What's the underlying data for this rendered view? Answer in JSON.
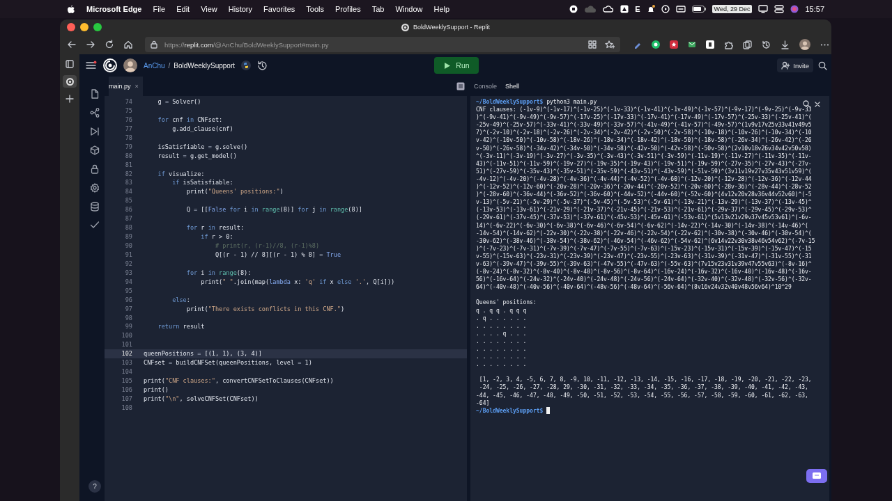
{
  "menu_bar": {
    "app": "Microsoft Edge",
    "menus": [
      "File",
      "Edit",
      "View",
      "History",
      "Favorites",
      "Tools",
      "Profiles",
      "Tab",
      "Window",
      "Help"
    ],
    "status_letter": "E",
    "date": "Wed, 29 Dec",
    "time": "15:57"
  },
  "browser": {
    "tab_title": "BoldWeeklySupport - Replit",
    "url": {
      "scheme": "https://",
      "host": "replit.com",
      "path": "/@AnChu/BoldWeeklySupport#main.py"
    }
  },
  "replit_header": {
    "user": "AnChu",
    "separator": "/",
    "repl": "BoldWeeklySupport",
    "run_label": "Run",
    "invite_label": "Invite"
  },
  "sidebar": {
    "help_label": "?"
  },
  "editor": {
    "tab": {
      "label": "main.py",
      "close": "×"
    },
    "lines": [
      {
        "number": "74",
        "active": false,
        "tokens": [
          {
            "text": "    g ",
            "kind": "plain"
          },
          {
            "text": "=",
            "kind": "op"
          },
          {
            "text": " Solver()",
            "kind": "plain"
          }
        ]
      },
      {
        "number": "75",
        "active": false
      },
      {
        "number": "76",
        "active": false,
        "tokens": [
          {
            "text": "    for",
            "kind": "keyword"
          },
          {
            "text": " cnf ",
            "kind": "plain"
          },
          {
            "text": "in",
            "kind": "keyword"
          },
          {
            "text": " CNFset:",
            "kind": "plain"
          }
        ]
      },
      {
        "number": "77",
        "active": false,
        "tokens": [
          {
            "text": "        g.add_clause(cnf)",
            "kind": "plain"
          }
        ]
      },
      {
        "number": "78",
        "active": false
      },
      {
        "number": "79",
        "active": false,
        "tokens": [
          {
            "text": "    isSatisfiable ",
            "kind": "plain"
          },
          {
            "text": "=",
            "kind": "op"
          },
          {
            "text": " g.solve()",
            "kind": "plain"
          }
        ]
      },
      {
        "number": "80",
        "active": false,
        "tokens": [
          {
            "text": "    result ",
            "kind": "plain"
          },
          {
            "text": "=",
            "kind": "op"
          },
          {
            "text": " g.get_model()",
            "kind": "plain"
          }
        ]
      },
      {
        "number": "81",
        "active": false
      },
      {
        "number": "82",
        "active": false,
        "tokens": [
          {
            "text": "    if",
            "kind": "keyword"
          },
          {
            "text": " visualize:",
            "kind": "plain"
          }
        ]
      },
      {
        "number": "83",
        "active": false,
        "tokens": [
          {
            "text": "        if",
            "kind": "keyword"
          },
          {
            "text": " isSatisfiable:",
            "kind": "plain"
          }
        ]
      },
      {
        "number": "84",
        "active": false,
        "tokens": [
          {
            "text": "            print(",
            "kind": "plain"
          },
          {
            "text": "\"Queens' positions:\"",
            "kind": "string"
          },
          {
            "text": ")",
            "kind": "plain"
          }
        ]
      },
      {
        "number": "85",
        "active": false
      },
      {
        "number": "86",
        "active": false,
        "tokens": [
          {
            "text": "            Q ",
            "kind": "plain"
          },
          {
            "text": "=",
            "kind": "op"
          },
          {
            "text": " [[",
            "kind": "plain"
          },
          {
            "text": "False",
            "kind": "constant"
          },
          {
            "text": " for",
            "kind": "keyword"
          },
          {
            "text": " i ",
            "kind": "plain"
          },
          {
            "text": "in",
            "kind": "keyword"
          },
          {
            "text": " range",
            "kind": "builtin"
          },
          {
            "text": "(8)] ",
            "kind": "plain"
          },
          {
            "text": "for",
            "kind": "keyword"
          },
          {
            "text": " j ",
            "kind": "plain"
          },
          {
            "text": "in",
            "kind": "keyword"
          },
          {
            "text": " range",
            "kind": "builtin"
          },
          {
            "text": "(8)]",
            "kind": "plain"
          }
        ]
      },
      {
        "number": "87",
        "active": false
      },
      {
        "number": "88",
        "active": false,
        "tokens": [
          {
            "text": "            for",
            "kind": "keyword"
          },
          {
            "text": " r ",
            "kind": "plain"
          },
          {
            "text": "in",
            "kind": "keyword"
          },
          {
            "text": " result:",
            "kind": "plain"
          }
        ]
      },
      {
        "number": "89",
        "active": false,
        "tokens": [
          {
            "text": "                if",
            "kind": "keyword"
          },
          {
            "text": " r > 0:",
            "kind": "plain"
          }
        ]
      },
      {
        "number": "90",
        "active": false,
        "tokens": [
          {
            "text": "                    # print(r, (r-1)//8, (r-1)%8)",
            "kind": "comment"
          }
        ]
      },
      {
        "number": "91",
        "active": false,
        "tokens": [
          {
            "text": "                    Q[(r - 1) // 8][(r - 1) % 8] ",
            "kind": "plain"
          },
          {
            "text": "=",
            "kind": "op"
          },
          {
            "text": " True",
            "kind": "constant"
          }
        ]
      },
      {
        "number": "92",
        "active": false
      },
      {
        "number": "93",
        "active": false,
        "tokens": [
          {
            "text": "            for",
            "kind": "keyword"
          },
          {
            "text": " i ",
            "kind": "plain"
          },
          {
            "text": "in",
            "kind": "keyword"
          },
          {
            "text": " range",
            "kind": "builtin"
          },
          {
            "text": "(8):",
            "kind": "plain"
          }
        ]
      },
      {
        "number": "94",
        "active": false,
        "tokens": [
          {
            "text": "                print(",
            "kind": "plain"
          },
          {
            "text": "\" \"",
            "kind": "string"
          },
          {
            "text": ".join(map(",
            "kind": "plain"
          },
          {
            "text": "lambda",
            "kind": "constant"
          },
          {
            "text": " x: ",
            "kind": "plain"
          },
          {
            "text": "'q'",
            "kind": "string"
          },
          {
            "text": " if",
            "kind": "keyword"
          },
          {
            "text": " x ",
            "kind": "plain"
          },
          {
            "text": "else",
            "kind": "keyword"
          },
          {
            "text": " '.'",
            "kind": "string"
          },
          {
            "text": ", Q[i]))",
            "kind": "plain"
          }
        ]
      },
      {
        "number": "95",
        "active": false
      },
      {
        "number": "96",
        "active": false,
        "tokens": [
          {
            "text": "        else",
            "kind": "keyword"
          },
          {
            "text": ":",
            "kind": "plain"
          }
        ]
      },
      {
        "number": "97",
        "active": false,
        "tokens": [
          {
            "text": "            print(",
            "kind": "plain"
          },
          {
            "text": "\"There exists conflicts in this CNF.\"",
            "kind": "string"
          },
          {
            "text": ")",
            "kind": "plain"
          }
        ]
      },
      {
        "number": "98",
        "active": false
      },
      {
        "number": "99",
        "active": false,
        "tokens": [
          {
            "text": "    return",
            "kind": "keyword"
          },
          {
            "text": " result",
            "kind": "plain"
          }
        ]
      },
      {
        "number": "100",
        "active": false
      },
      {
        "number": "101",
        "active": false
      },
      {
        "number": "102",
        "active": true,
        "tokens": [
          {
            "text": "queenPositions ",
            "kind": "plain"
          },
          {
            "text": "=",
            "kind": "op"
          },
          {
            "text": " [(1, 1), (3, 4)]",
            "kind": "plain"
          }
        ]
      },
      {
        "number": "103",
        "active": false,
        "tokens": [
          {
            "text": "CNFset ",
            "kind": "plain"
          },
          {
            "text": "=",
            "kind": "op"
          },
          {
            "text": " buildCNFSet(queenPositions, level ",
            "kind": "plain"
          },
          {
            "text": "=",
            "kind": "op"
          },
          {
            "text": " 1)",
            "kind": "plain"
          }
        ]
      },
      {
        "number": "104",
        "active": false
      },
      {
        "number": "105",
        "active": false,
        "tokens": [
          {
            "text": "print(",
            "kind": "plain"
          },
          {
            "text": "\"CNF clauses:\"",
            "kind": "string"
          },
          {
            "text": ", convertCNFSetToClauses(CNFset))",
            "kind": "plain"
          }
        ]
      },
      {
        "number": "106",
        "active": false,
        "tokens": [
          {
            "text": "print()",
            "kind": "plain"
          }
        ]
      },
      {
        "number": "107",
        "active": false,
        "tokens": [
          {
            "text": "print(",
            "kind": "plain"
          },
          {
            "text": "\"\\n\"",
            "kind": "string"
          },
          {
            "text": ", solveCNFSet(CNFset))",
            "kind": "plain"
          }
        ]
      },
      {
        "number": "108",
        "active": false
      }
    ]
  },
  "output_panel": {
    "tabs": [
      {
        "label": "Console",
        "selected": false
      },
      {
        "label": "Shell",
        "selected": true
      }
    ],
    "blocks": [
      {
        "lines": [
          {
            "kind": "prompt",
            "prompt": "~/BoldWeeklySupport$",
            "command": "python3 main.py"
          },
          {
            "kind": "text",
            "text": "CNF clauses: (-1v-9)^(-1v-17)^(-1v-25)^(-1v-33)^(-1v-41)^(-1v-49)^(-1v-57)^(-9v-17)^(-9v-25)^(-9v-33"
          },
          {
            "kind": "text",
            "text": ")^(-9v-41)^(-9v-49)^(-9v-57)^(-17v-25)^(-17v-33)^(-17v-41)^(-17v-49)^(-17v-57)^(-25v-33)^(-25v-41)^("
          },
          {
            "kind": "text",
            "text": "-25v-49)^(-25v-57)^(-33v-41)^(-33v-49)^(-33v-57)^(-41v-49)^(-41v-57)^(-49v-57)^(1v9v17v25v33v41v49v5"
          },
          {
            "kind": "text",
            "text": "7)^(-2v-10)^(-2v-18)^(-2v-26)^(-2v-34)^(-2v-42)^(-2v-50)^(-2v-58)^(-10v-18)^(-10v-26)^(-10v-34)^(-10"
          },
          {
            "kind": "text",
            "text": "v-42)^(-10v-50)^(-10v-58)^(-18v-26)^(-18v-34)^(-18v-42)^(-18v-50)^(-18v-58)^(-26v-34)^(-26v-42)^(-26"
          },
          {
            "kind": "text",
            "text": "v-50)^(-26v-58)^(-34v-42)^(-34v-50)^(-34v-58)^(-42v-50)^(-42v-58)^(-50v-58)^(2v10v18v26v34v42v50v58)"
          },
          {
            "kind": "text",
            "text": "^(-3v-11)^(-3v-19)^(-3v-27)^(-3v-35)^(-3v-43)^(-3v-51)^(-3v-59)^(-11v-19)^(-11v-27)^(-11v-35)^(-11v-"
          },
          {
            "kind": "text",
            "text": "43)^(-11v-51)^(-11v-59)^(-19v-27)^(-19v-35)^(-19v-43)^(-19v-51)^(-19v-59)^(-27v-35)^(-27v-43)^(-27v-"
          },
          {
            "kind": "text",
            "text": "51)^(-27v-59)^(-35v-43)^(-35v-51)^(-35v-59)^(-43v-51)^(-43v-59)^(-51v-59)^(3v11v19v27v35v43v51v59)^("
          },
          {
            "kind": "text",
            "text": "-4v-12)^(-4v-20)^(-4v-28)^(-4v-36)^(-4v-44)^(-4v-52)^(-4v-60)^(-12v-20)^(-12v-28)^(-12v-36)^(-12v-44"
          },
          {
            "kind": "text",
            "text": ")^(-12v-52)^(-12v-60)^(-20v-28)^(-20v-36)^(-20v-44)^(-20v-52)^(-20v-60)^(-28v-36)^(-28v-44)^(-28v-52"
          },
          {
            "kind": "text",
            "text": ")^(-28v-60)^(-36v-44)^(-36v-52)^(-36v-60)^(-44v-52)^(-44v-60)^(-52v-60)^(4v12v20v28v36v44v52v60)^(-5"
          },
          {
            "kind": "text",
            "text": "v-13)^(-5v-21)^(-5v-29)^(-5v-37)^(-5v-45)^(-5v-53)^(-5v-61)^(-13v-21)^(-13v-29)^(-13v-37)^(-13v-45)^"
          },
          {
            "kind": "text",
            "text": "(-13v-53)^(-13v-61)^(-21v-29)^(-21v-37)^(-21v-45)^(-21v-53)^(-21v-61)^(-29v-37)^(-29v-45)^(-29v-53)^"
          },
          {
            "kind": "text",
            "text": "(-29v-61)^(-37v-45)^(-37v-53)^(-37v-61)^(-45v-53)^(-45v-61)^(-53v-61)^(5v13v21v29v37v45v53v61)^(-6v-"
          },
          {
            "kind": "text",
            "text": "14)^(-6v-22)^(-6v-30)^(-6v-38)^(-6v-46)^(-6v-54)^(-6v-62)^(-14v-22)^(-14v-30)^(-14v-38)^(-14v-46)^("
          },
          {
            "kind": "text",
            "text": "-14v-54)^(-14v-62)^(-22v-30)^(-22v-38)^(-22v-46)^(-22v-54)^(-22v-62)^(-30v-38)^(-30v-46)^(-30v-54)^("
          },
          {
            "kind": "text",
            "text": "-30v-62)^(-38v-46)^(-38v-54)^(-38v-62)^(-46v-54)^(-46v-62)^(-54v-62)^(6v14v22v30v38v46v54v62)^(-7v-15"
          },
          {
            "kind": "text",
            "text": ")^(-7v-23)^(-7v-31)^(-7v-39)^(-7v-47)^(-7v-55)^(-7v-63)^(-15v-23)^(-15v-31)^(-15v-39)^(-15v-47)^(-15"
          },
          {
            "kind": "text",
            "text": "v-55)^(-15v-63)^(-23v-31)^(-23v-39)^(-23v-47)^(-23v-55)^(-23v-63)^(-31v-39)^(-31v-47)^(-31v-55)^(-31"
          },
          {
            "kind": "text",
            "text": "v-63)^(-39v-47)^(-39v-55)^(-39v-63)^(-47v-55)^(-47v-63)^(-55v-63)^(7v15v23v31v39v47v55v63)^(-8v-16)^"
          },
          {
            "kind": "text",
            "text": "(-8v-24)^(-8v-32)^(-8v-40)^(-8v-48)^(-8v-56)^(-8v-64)^(-16v-24)^(-16v-32)^(-16v-40)^(-16v-48)^(-16v-"
          },
          {
            "kind": "text",
            "text": "56)^(-16v-64)^(-24v-32)^(-24v-40)^(-24v-48)^(-24v-56)^(-24v-64)^(-32v-40)^(-32v-48)^(-32v-56)^(-32v-"
          },
          {
            "kind": "text",
            "text": "64)^(-40v-48)^(-40v-56)^(-40v-64)^(-48v-56)^(-48v-64)^(-56v-64)^(8v16v24v32v40v48v56v64)^10^29"
          }
        ]
      },
      {
        "lines": [
          {
            "kind": "text",
            "text": "Queens' positions:"
          },
          {
            "kind": "text",
            "text": "q . q q . q q q"
          },
          {
            "kind": "text",
            "text": ". q . . . . . ."
          },
          {
            "kind": "text",
            "text": ". . . . . . . ."
          },
          {
            "kind": "text",
            "text": ". . . . q . . ."
          },
          {
            "kind": "text",
            "text": ". . . . . . . ."
          },
          {
            "kind": "text",
            "text": ". . . . . . . ."
          },
          {
            "kind": "text",
            "text": ". . . . . . . ."
          },
          {
            "kind": "text",
            "text": ". . . . . . . ."
          }
        ]
      },
      {
        "lines": [
          {
            "kind": "text",
            "text": " [1, -2, 3, 4, -5, 6, 7, 8, -9, 10, -11, -12, -13, -14, -15, -16, -17, -18, -19, -20, -21, -22, -23,"
          },
          {
            "kind": "text",
            "text": " -24, -25, -26, -27, -28, 29, -30, -31, -32, -33, -34, -35, -36, -37, -38, -39, -40, -41, -42, -43,"
          },
          {
            "kind": "text",
            "text": "-44, -45, -46, -47, -48, -49, -50, -51, -52, -53, -54, -55, -56, -57, -58, -59, -60, -61, -62, -63,"
          },
          {
            "kind": "text",
            "text": "-64]"
          },
          {
            "kind": "prompt",
            "prompt": "~/BoldWeeklySupport$",
            "cursor": true
          }
        ]
      }
    ]
  }
}
